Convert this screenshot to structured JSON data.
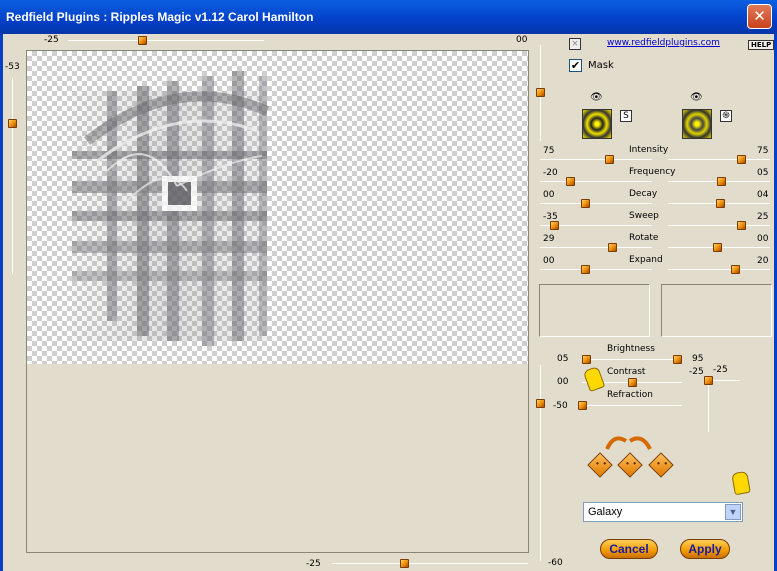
{
  "window": {
    "title": "Redfield Plugins : Ripples Magic v1.12   Carol Hamilton",
    "close_glyph": "✕"
  },
  "preview": {
    "top_slider_value": "-25",
    "top_right_value": "00",
    "left_slider_value": "-53",
    "bottom_slider_value": "-25"
  },
  "right_top": {
    "link": "www.redfieldplugins.com",
    "help_label": "HELP",
    "mask_label": "Mask",
    "mask_checked": "✔"
  },
  "params": [
    {
      "name": "Intensity",
      "left": "75",
      "right": "75",
      "left_frac": 0.63,
      "right_frac": 0.74
    },
    {
      "name": "Frequency",
      "left": "-20",
      "right": "05",
      "left_frac": 0.25,
      "right_frac": 0.53
    },
    {
      "name": "Decay",
      "left": "00",
      "right": "04",
      "left_frac": 0.4,
      "right_frac": 0.52
    },
    {
      "name": "Sweep",
      "left": "-35",
      "right": "25",
      "left_frac": 0.1,
      "right_frac": 0.74
    },
    {
      "name": "Rotate",
      "left": "29",
      "right": "00",
      "left_frac": 0.66,
      "right_frac": 0.48
    },
    {
      "name": "Expand",
      "left": "00",
      "right": "20",
      "left_frac": 0.4,
      "right_frac": 0.68
    }
  ],
  "lighting": {
    "brightness_label": "Brightness",
    "brightness_left": "05",
    "brightness_right": "95",
    "contrast_label": "Contrast",
    "contrast_left": "00",
    "contrast_right_a": "-25",
    "contrast_right_b": "-25",
    "refraction_label": "Refraction",
    "refraction_left": "-50",
    "vertical_value": "-60"
  },
  "preset": {
    "selected": "Galaxy",
    "arrow": "▼"
  },
  "buttons": {
    "cancel": "Cancel",
    "apply": "Apply"
  },
  "icon_glyphs": {
    "eye": "👁",
    "s_button": "S",
    "swirl_button": "֍"
  },
  "colors": {
    "titlebar": "#0340c8",
    "background": "#e2dccd",
    "accent_orange": "#e78400",
    "swatch_yellow": "#d4c400"
  }
}
